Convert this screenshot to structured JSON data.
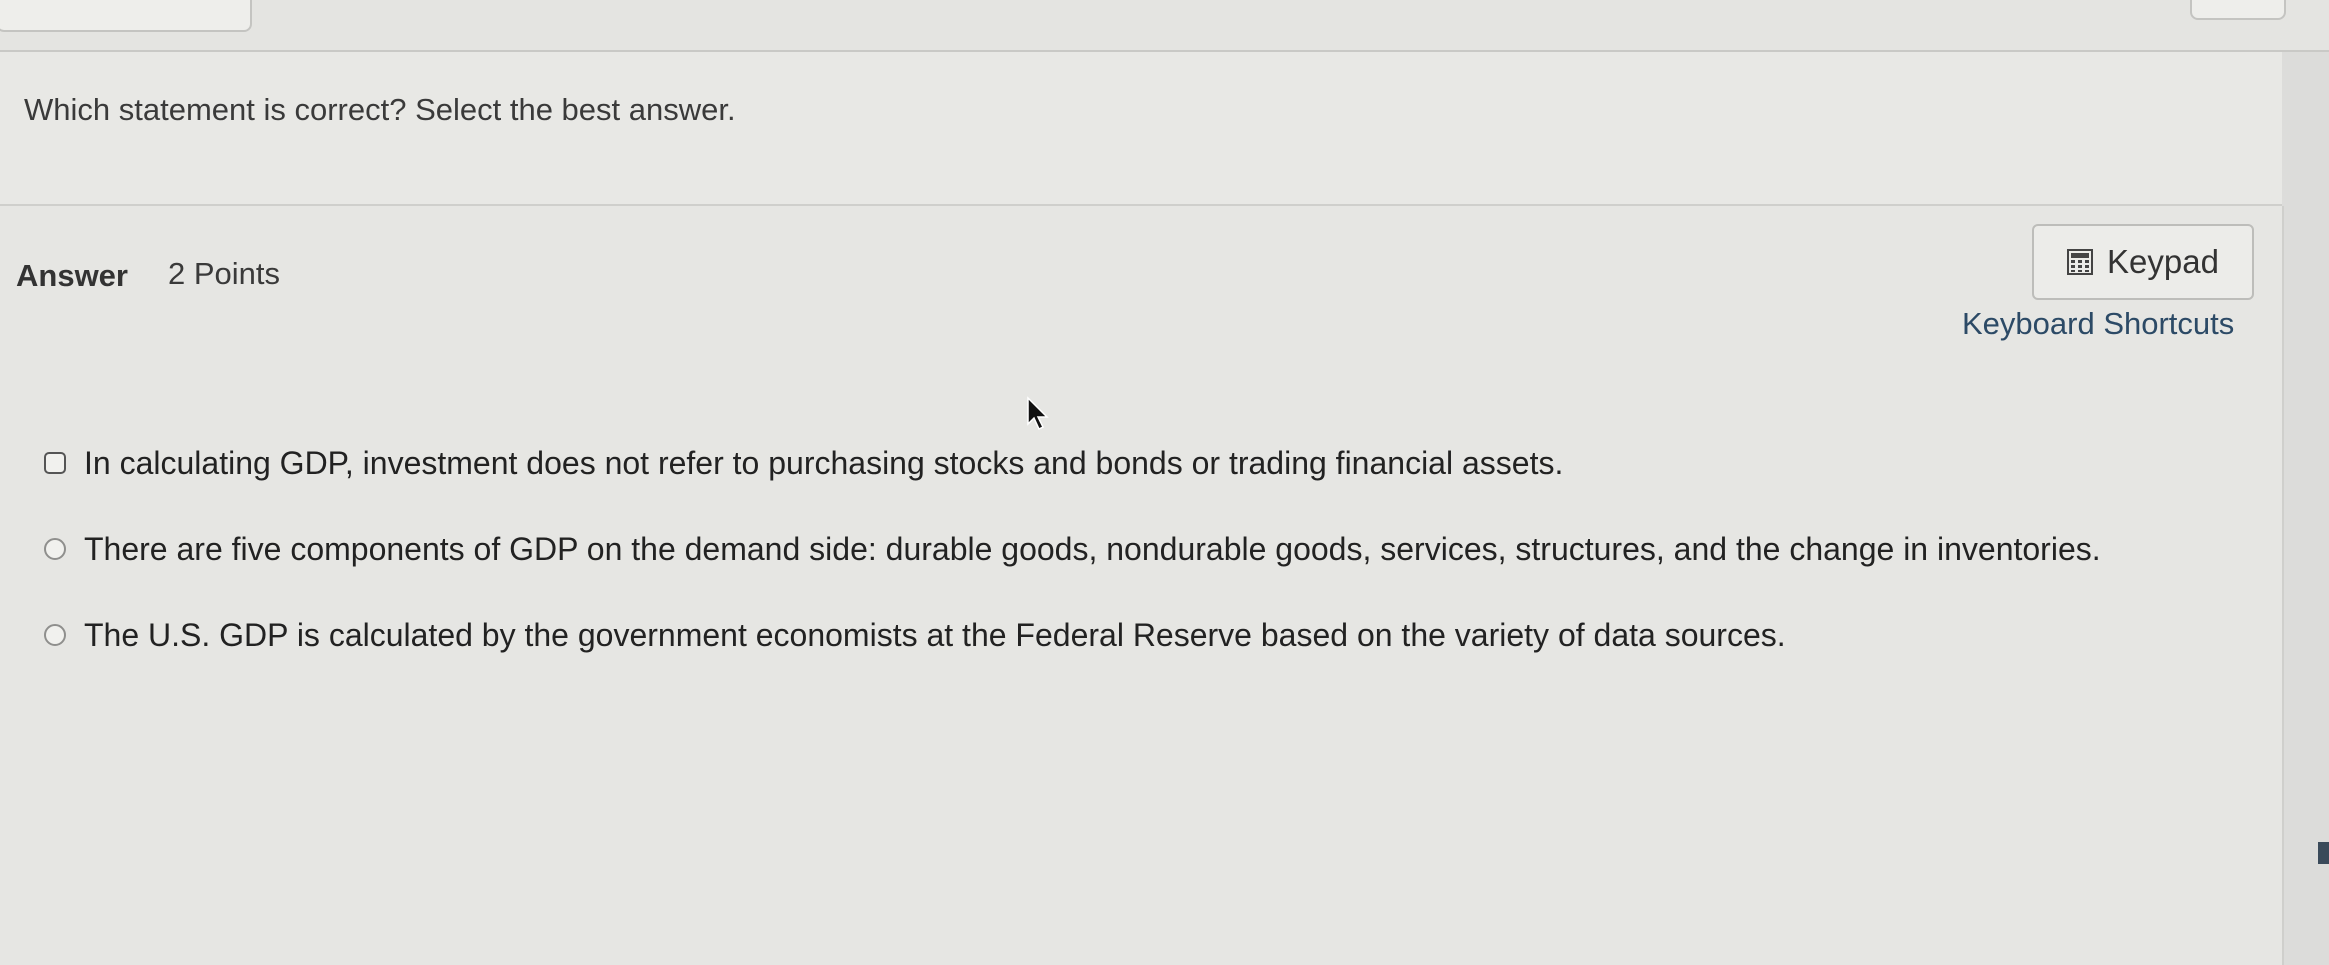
{
  "question": {
    "text": "Which statement is correct? Select the best answer."
  },
  "answer": {
    "heading": "Answer",
    "points": "2 Points"
  },
  "toolbar": {
    "keypad_label": "Keypad",
    "keypad_icon": "calculator-icon",
    "shortcuts_label": "Keyboard Shortcuts"
  },
  "options": [
    {
      "label": "In calculating GDP, investment does not refer to purchasing stocks and bonds or trading financial assets."
    },
    {
      "label": "There are five components of GDP on the demand side: durable goods, nondurable goods, services, structures, and the change in inventories."
    },
    {
      "label": "The U.S. GDP is calculated by the government economists at the Federal Reserve based on the variety of data sources."
    }
  ],
  "colors": {
    "link": "#2c4a66",
    "text": "#222222",
    "background": "#e6e6e3"
  }
}
